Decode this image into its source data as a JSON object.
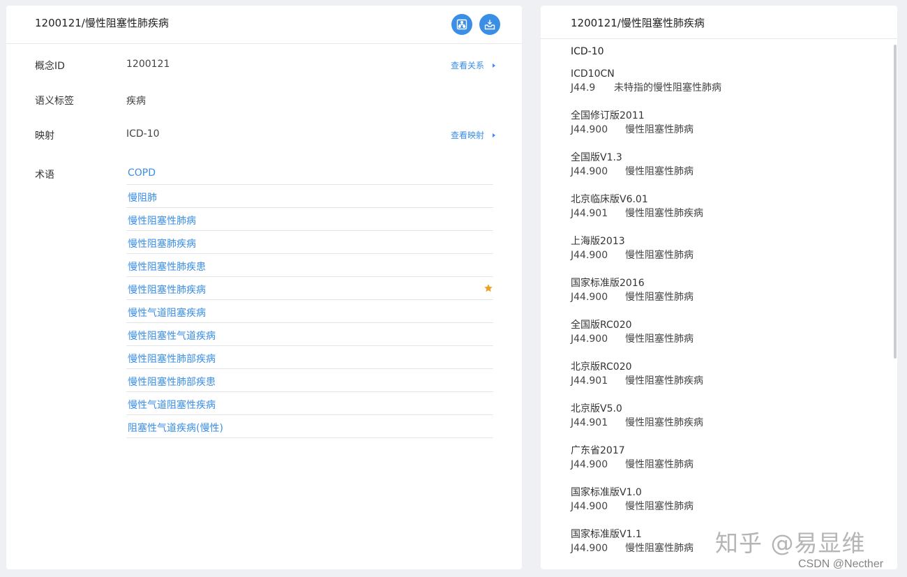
{
  "left": {
    "title": "1200121/慢性阻塞性肺疾病",
    "icons": {
      "relation": "relation-graph-icon",
      "export": "export-tray-icon"
    },
    "fields": {
      "id_label": "概念ID",
      "id_value": "1200121",
      "id_link": "查看关系",
      "tag_label": "语义标签",
      "tag_value": "疾病",
      "map_label": "映射",
      "map_value": "ICD-10",
      "map_link": "查看映射",
      "terms_label": "术语"
    },
    "terms": [
      "COPD",
      "慢阻肺",
      "慢性阻塞性肺病",
      "慢性阻塞肺疾病",
      "慢性阻塞性肺疾患",
      "慢性阻塞性肺疾病",
      "慢性气道阻塞疾病",
      "慢性阻塞性气道疾病",
      "慢性阻塞性肺部疾病",
      "慢性阻塞性肺部疾患",
      "慢性气道阻塞性疾病",
      "阻塞性气道疾病(慢性)"
    ],
    "preferred_term_index": 5,
    "accent_color": "#3a8ee6",
    "star_color": "#f0a020"
  },
  "right": {
    "title": "1200121/慢性阻塞性肺疾病",
    "heading": "ICD-10",
    "mappings": [
      {
        "version": "ICD10CN",
        "code": "J44.9",
        "name": "未特指的慢性阻塞性肺病"
      },
      {
        "version": "全国修订版2011",
        "code": "J44.900",
        "name": "慢性阻塞性肺病"
      },
      {
        "version": "全国版V1.3",
        "code": "J44.900",
        "name": "慢性阻塞性肺病"
      },
      {
        "version": "北京临床版V6.01",
        "code": "J44.901",
        "name": "慢性阻塞性肺疾病"
      },
      {
        "version": "上海版2013",
        "code": "J44.900",
        "name": "慢性阻塞性肺病"
      },
      {
        "version": "国家标准版2016",
        "code": "J44.900",
        "name": "慢性阻塞性肺病"
      },
      {
        "version": "全国版RC020",
        "code": "J44.900",
        "name": "慢性阻塞性肺病"
      },
      {
        "version": "北京版RC020",
        "code": "J44.901",
        "name": "慢性阻塞性肺疾病"
      },
      {
        "version": "北京版V5.0",
        "code": "J44.901",
        "name": "慢性阻塞性肺疾病"
      },
      {
        "version": "广东省2017",
        "code": "J44.900",
        "name": "慢性阻塞性肺病"
      },
      {
        "version": "国家标准版V1.0",
        "code": "J44.900",
        "name": "慢性阻塞性肺病"
      },
      {
        "version": "国家标准版V1.1",
        "code": "J44.900",
        "name": "慢性阻塞性肺病"
      }
    ]
  },
  "watermark": "知乎 @易显维",
  "credit": "CSDN @Necther"
}
